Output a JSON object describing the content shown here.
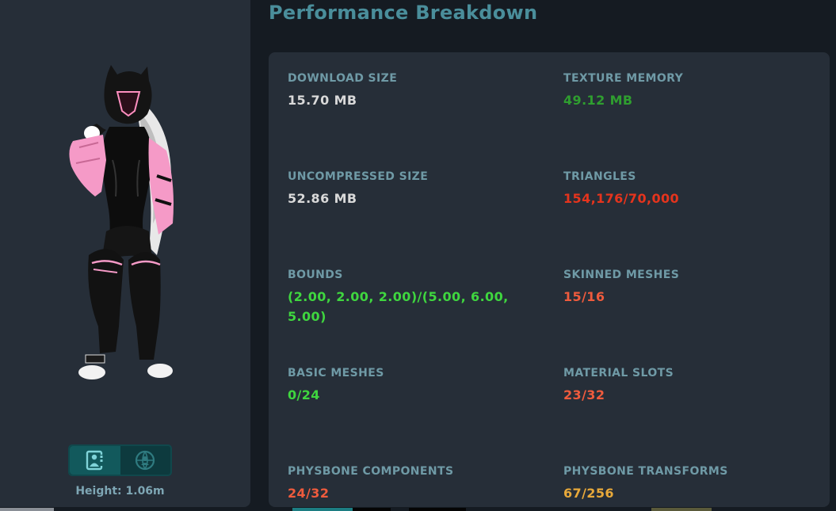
{
  "page": {
    "title": "Performance Breakdown"
  },
  "avatar_panel": {
    "height_text": "Height: 1.06m",
    "view_toggle": [
      {
        "icon": "avatar-info-icon",
        "active": true
      },
      {
        "icon": "avatar-globe-icon",
        "active": false
      }
    ]
  },
  "stats": [
    {
      "id": "download-size",
      "label": "DOWNLOAD SIZE",
      "value": "15.70 MB",
      "color": "#d9d9d9"
    },
    {
      "id": "texture-memory",
      "label": "TEXTURE MEMORY",
      "value": "49.12 MB",
      "color": "#2f9e2f"
    },
    {
      "id": "uncompressed-size",
      "label": "UNCOMPRESSED SIZE",
      "value": "52.86 MB",
      "color": "#d9d9d9"
    },
    {
      "id": "triangles",
      "label": "TRIANGLES",
      "value": "154,176/70,000",
      "color": "#e5341d"
    },
    {
      "id": "bounds",
      "label": "BOUNDS",
      "value": "(2.00, 2.00, 2.00)/(5.00, 6.00, 5.00)",
      "color": "#3fd63f"
    },
    {
      "id": "skinned-meshes",
      "label": "SKINNED MESHES",
      "value": "15/16",
      "color": "#ef5b3d"
    },
    {
      "id": "basic-meshes",
      "label": "BASIC MESHES",
      "value": "0/24",
      "color": "#3fd63f"
    },
    {
      "id": "material-slots",
      "label": "MATERIAL SLOTS",
      "value": "23/32",
      "color": "#ef5b3d"
    },
    {
      "id": "physbone-components",
      "label": "PHYSBONE COMPONENTS",
      "value": "24/32",
      "color": "#ef5b3d"
    },
    {
      "id": "physbone-transforms",
      "label": "PHYSBONE TRANSFORMS",
      "value": "67/256",
      "color": "#e8a93a"
    }
  ]
}
